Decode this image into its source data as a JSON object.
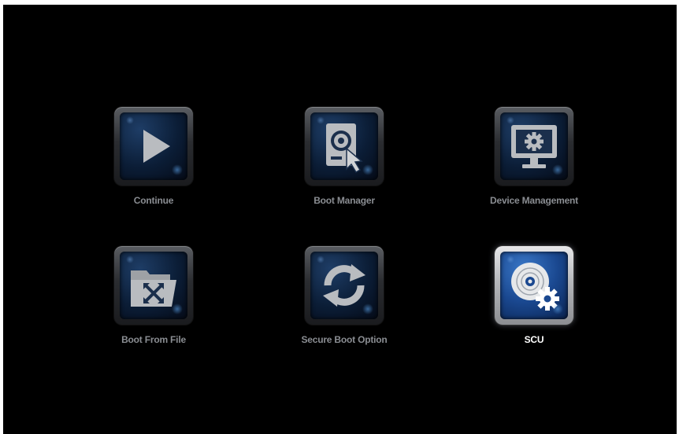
{
  "menu": {
    "items": [
      {
        "label": "Continue",
        "icon": "play-icon"
      },
      {
        "label": "Boot Manager",
        "icon": "boot-drive-icon"
      },
      {
        "label": "Device Management",
        "icon": "monitor-gear-icon"
      },
      {
        "label": "Boot From File",
        "icon": "folder-icon"
      },
      {
        "label": "Secure Boot Option",
        "icon": "refresh-icon"
      },
      {
        "label": "SCU",
        "icon": "disc-gear-icon",
        "selected": true
      }
    ]
  },
  "colors": {
    "background": "#000000",
    "label": "#8a8d92",
    "label_selected": "#ffffff",
    "icon_glyph": "#b9bcc0"
  }
}
